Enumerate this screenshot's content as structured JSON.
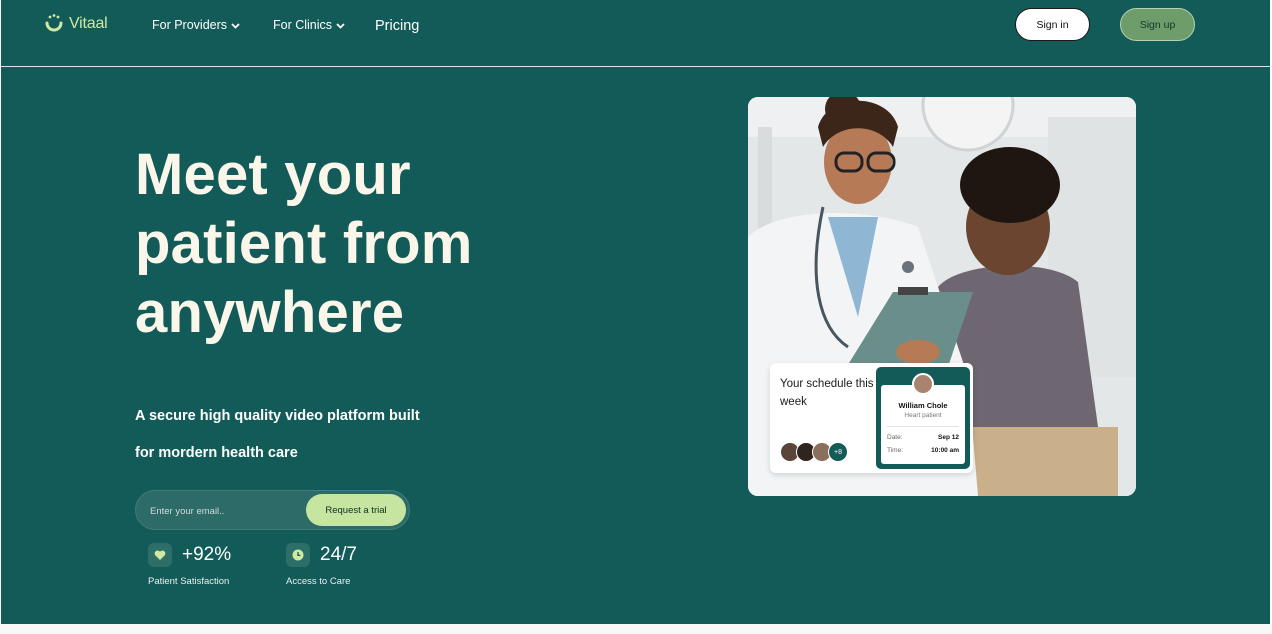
{
  "brand": {
    "name": "Vitaal",
    "accent": "#cfe9a3",
    "background": "#135b58"
  },
  "nav": {
    "providers_label": "For Providers",
    "clinics_label": "For Clinics",
    "pricing_label": "Pricing",
    "signin_label": "Sign in",
    "signup_label": "Sign up"
  },
  "hero": {
    "headline": "Meet your patient from anywhere",
    "subline_1": "A secure high quality video platform built",
    "subline_2": "for mordern health care",
    "email_placeholder": "Enter your email..",
    "cta_label": "Request a trial"
  },
  "stats": [
    {
      "icon": "heart-icon",
      "value": "+92%",
      "label": "Patient Satisfaction"
    },
    {
      "icon": "clock-icon",
      "value": "24/7",
      "label": "Access to Care"
    }
  ],
  "schedule_card": {
    "title": "Your schedule this week",
    "more_count": "+8",
    "patient": {
      "name": "William Chole",
      "condition": "Heart patient",
      "date_label": "Date:",
      "date_value": "Sep 12",
      "time_label": "Time:",
      "time_value": "10:00 am"
    }
  }
}
